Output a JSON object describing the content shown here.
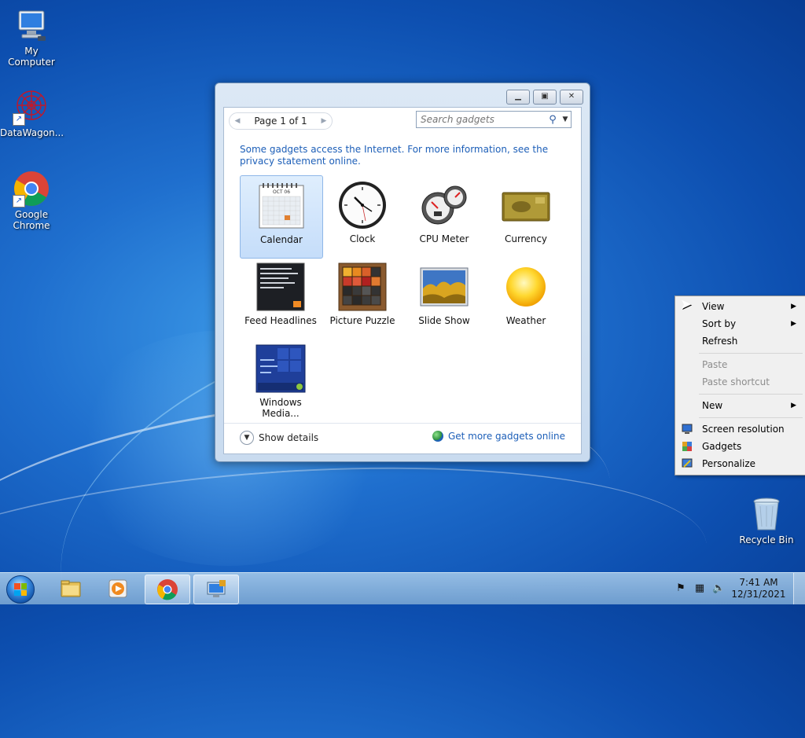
{
  "desktop": {
    "icons": [
      {
        "label": "My Computer"
      },
      {
        "label": "DataWagon..."
      },
      {
        "label": "Google Chrome"
      },
      {
        "label": "Recycle Bin"
      }
    ]
  },
  "gadget_window": {
    "pager_label": "Page 1 of 1",
    "search_placeholder": "Search gadgets",
    "notice": "Some gadgets access the Internet.  For more information, see the privacy statement online.",
    "gadgets": [
      {
        "label": "Calendar",
        "selected": true
      },
      {
        "label": "Clock"
      },
      {
        "label": "CPU Meter"
      },
      {
        "label": "Currency"
      },
      {
        "label": "Feed Headlines"
      },
      {
        "label": "Picture Puzzle"
      },
      {
        "label": "Slide Show"
      },
      {
        "label": "Weather"
      },
      {
        "label": "Windows Media..."
      }
    ],
    "calendar_month": "OCT 06",
    "show_details": "Show details",
    "get_more": "Get more gadgets online"
  },
  "context_menu": {
    "items": [
      {
        "label": "View",
        "submenu": true
      },
      {
        "label": "Sort by",
        "submenu": true
      },
      {
        "label": "Refresh"
      },
      {
        "label": "Paste",
        "disabled": true
      },
      {
        "label": "Paste shortcut",
        "disabled": true
      },
      {
        "label": "New",
        "submenu": true
      },
      {
        "label": "Screen resolution",
        "icon": "monitor-icon"
      },
      {
        "label": "Gadgets",
        "icon": "gadgets-icon"
      },
      {
        "label": "Personalize",
        "icon": "personalize-icon"
      }
    ]
  },
  "taskbar": {
    "clock_time": "7:41 AM",
    "clock_date": "12/31/2021",
    "apps": [
      "file-explorer-icon",
      "media-player-icon",
      "chrome-icon",
      "remote-desktop-icon"
    ]
  },
  "colors": {
    "link_blue": "#1d5fb8",
    "desktop_blue": "#1f6fce"
  }
}
